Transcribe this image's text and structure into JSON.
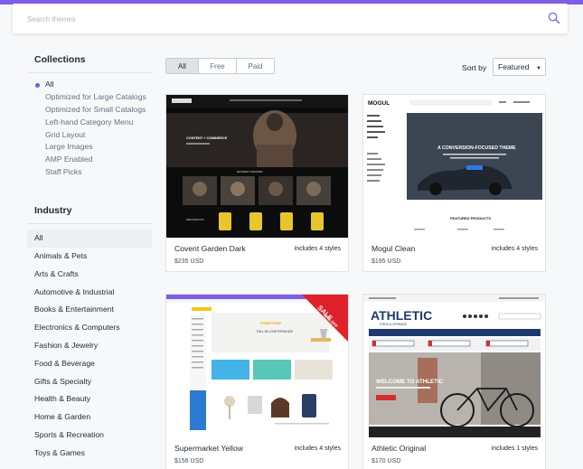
{
  "search": {
    "placeholder": "Search themes"
  },
  "filters": {
    "options": [
      "All",
      "Free",
      "Paid"
    ],
    "active": "All"
  },
  "sort": {
    "label": "Sort by",
    "selected": "Featured"
  },
  "collections": {
    "title": "Collections",
    "items": [
      "All",
      "Optimized for Large Catalogs",
      "Optimized for Small Catalogs",
      "Left-hand Category Menu",
      "Grid Layout",
      "Large Images",
      "AMP Enabled",
      "Staff Picks"
    ],
    "selected": "All"
  },
  "industry": {
    "title": "Industry",
    "items": [
      "All",
      "Animals & Pets",
      "Arts & Crafts",
      "Automotive & Industrial",
      "Books & Entertainment",
      "Electronics & Computers",
      "Fashion & Jewelry",
      "Food & Beverage",
      "Gifts & Specialty",
      "Health & Beauty",
      "Home & Garden",
      "Sports & Recreation",
      "Toys & Games"
    ],
    "selected": "All"
  },
  "themes": [
    {
      "name": "Covent Garden Dark",
      "styles": "includes 4 styles",
      "price": "$235 USD",
      "preview": {
        "hero_text": "CONTENT + COMMERCE",
        "section_label": "FEATURED CATEGORIES",
        "product_label": "NEW PRODUCTS"
      }
    },
    {
      "name": "Mogul Clean",
      "styles": "includes 4 styles",
      "price": "$195 USD",
      "preview": {
        "logo": "MOGUL",
        "hero_text": "A CONVERSION-FOCUSED THEME",
        "section_label": "FEATURED PRODUCTS"
      }
    },
    {
      "name": "Supermarket Yellow",
      "styles": "includes 4 styles",
      "price": "$156 USD",
      "preview": {
        "ribbon": "SALE",
        "ribbon_sub": "20% OFF",
        "hero_text": "FALL IN LOVE FROM $49",
        "hero_kicker": "FURNITURE"
      }
    },
    {
      "name": "Athletic Original",
      "styles": "includes 1 styles",
      "price": "$170 USD",
      "preview": {
        "logo": "ATHLETIC",
        "logo_sub": "STENCIL UPGRADE",
        "hero_text": "WELCOME TO ATHLETIC"
      }
    }
  ],
  "colors": {
    "accent": "#7f5fe6",
    "selected_radio": "#5c6ac4",
    "sale_ribbon": "#e0202a",
    "athletic_navy": "#1e3a6e"
  }
}
